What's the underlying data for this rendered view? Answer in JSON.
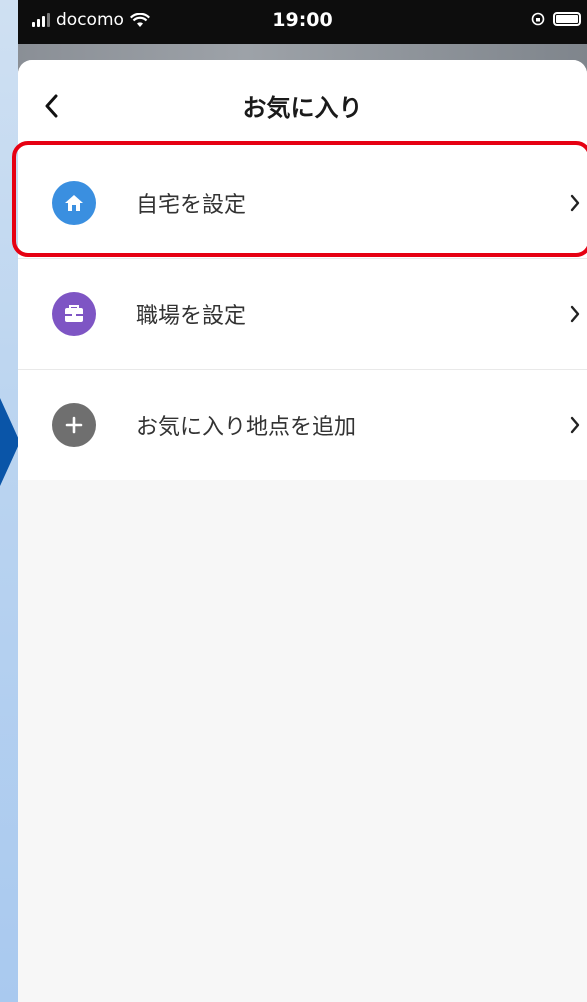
{
  "status_bar": {
    "carrier": "docomo",
    "time": "19:00"
  },
  "nav": {
    "title": "お気に入り"
  },
  "items": [
    {
      "label": "自宅を設定",
      "icon": "home-icon",
      "color": "#3a8fe0"
    },
    {
      "label": "職場を設定",
      "icon": "briefcase-icon",
      "color": "#7e55c4"
    },
    {
      "label": "お気に入り地点を追加",
      "icon": "plus-icon",
      "color": "#6f6f6f"
    }
  ],
  "colors": {
    "highlight": "#e60012",
    "side_arrow": "#0a55a8"
  }
}
